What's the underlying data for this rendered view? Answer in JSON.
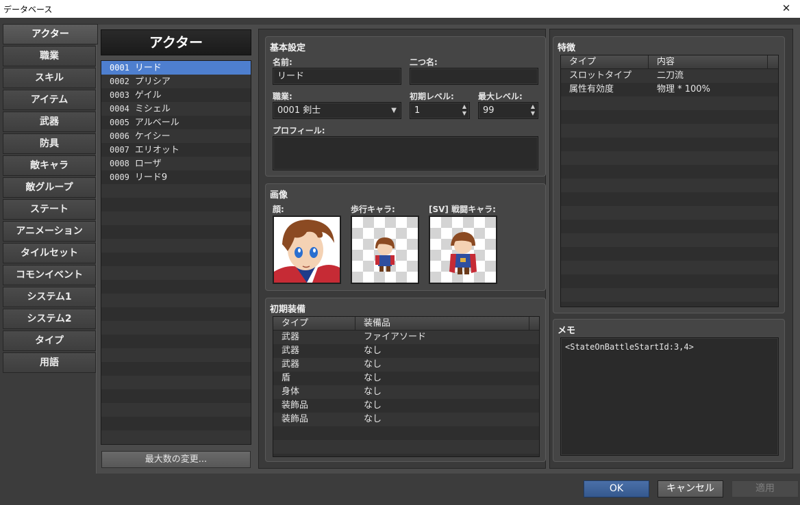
{
  "window": {
    "title": "データベース"
  },
  "tabs": [
    {
      "label": "アクター",
      "active": true
    },
    {
      "label": "職業"
    },
    {
      "label": "スキル"
    },
    {
      "label": "アイテム"
    },
    {
      "label": "武器"
    },
    {
      "label": "防具"
    },
    {
      "label": "敵キャラ"
    },
    {
      "label": "敵グループ"
    },
    {
      "label": "ステート"
    },
    {
      "label": "アニメーション"
    },
    {
      "label": "タイルセット"
    },
    {
      "label": "コモンイベント"
    },
    {
      "label": "システム1"
    },
    {
      "label": "システム2"
    },
    {
      "label": "タイプ"
    },
    {
      "label": "用語"
    }
  ],
  "actor_list": {
    "header": "アクター",
    "items": [
      {
        "id": "0001",
        "name": "リード",
        "selected": true
      },
      {
        "id": "0002",
        "name": "プリシア"
      },
      {
        "id": "0003",
        "name": "ゲイル"
      },
      {
        "id": "0004",
        "name": "ミシェル"
      },
      {
        "id": "0005",
        "name": "アルベール"
      },
      {
        "id": "0006",
        "name": "ケイシー"
      },
      {
        "id": "0007",
        "name": "エリオット"
      },
      {
        "id": "0008",
        "name": "ローザ"
      },
      {
        "id": "0009",
        "name": "リード9"
      }
    ],
    "max_button": "最大数の変更..."
  },
  "general": {
    "title": "基本設定",
    "name_label": "名前:",
    "name_value": "リード",
    "nickname_label": "二つ名:",
    "nickname_value": "",
    "class_label": "職業:",
    "class_value": "0001 剣士",
    "initial_level_label": "初期レベル:",
    "initial_level_value": "1",
    "max_level_label": "最大レベル:",
    "max_level_value": "99",
    "profile_label": "プロフィール:",
    "profile_value": ""
  },
  "images": {
    "title": "画像",
    "face_label": "顔:",
    "character_label": "歩行キャラ:",
    "battler_label": "[SV] 戦闘キャラ:"
  },
  "equipment": {
    "title": "初期装備",
    "col_type": "タイプ",
    "col_item": "装備品",
    "rows": [
      {
        "type": "武器",
        "item": "ファイアソード"
      },
      {
        "type": "武器",
        "item": "なし"
      },
      {
        "type": "武器",
        "item": "なし"
      },
      {
        "type": "盾",
        "item": "なし"
      },
      {
        "type": "身体",
        "item": "なし"
      },
      {
        "type": "装飾品",
        "item": "なし"
      },
      {
        "type": "装飾品",
        "item": "なし"
      }
    ]
  },
  "traits": {
    "title": "特徴",
    "col_type": "タイプ",
    "col_content": "内容",
    "rows": [
      {
        "type": "スロットタイプ",
        "content": "二刀流"
      },
      {
        "type": "属性有効度",
        "content": "物理 * 100%"
      }
    ]
  },
  "memo": {
    "title": "メモ",
    "value": "<StateOnBattleStartId:3,4>"
  },
  "buttons": {
    "ok": "OK",
    "cancel": "キャンセル",
    "apply": "適用"
  }
}
